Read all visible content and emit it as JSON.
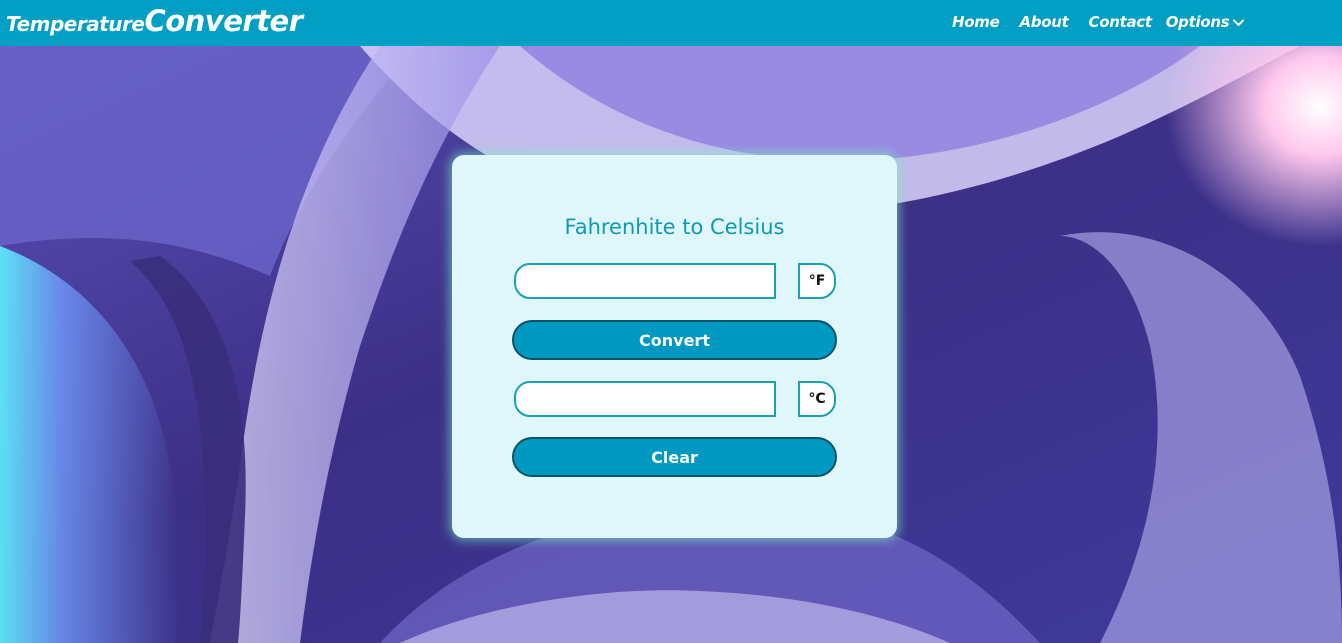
{
  "header": {
    "brand_part1": "Temperature",
    "brand_part2": "Converter",
    "nav": {
      "home": "Home",
      "about": "About",
      "contact": "Contact",
      "options": "Options"
    },
    "options_icon": "chevron-down-icon",
    "background_color": "#009fc3"
  },
  "converter": {
    "title": "Fahrenhite to Celsius",
    "fahrenheit": {
      "value": "",
      "unit": "°F"
    },
    "convert_label": "Convert",
    "celsius": {
      "value": "",
      "unit": "°C"
    },
    "clear_label": "Clear"
  },
  "colors": {
    "accent": "#0099c2",
    "title": "#0f9bb5",
    "card": "#dff6fb"
  }
}
